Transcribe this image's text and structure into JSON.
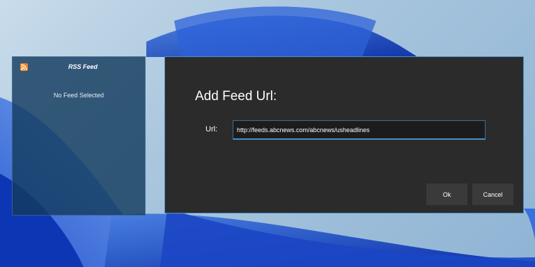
{
  "desktop": {
    "wallpaper": "windows-11-bloom"
  },
  "rss_widget": {
    "icon": "rss-icon",
    "title": "RSS Feed",
    "empty_message": "No Feed Selected",
    "accent_color": "#f08a24"
  },
  "add_feed_dialog": {
    "heading": "Add Feed Url:",
    "url_label": "Url:",
    "url_value": "http://feeds.abcnews.com/abcnews/usheadlines",
    "ok_label": "Ok",
    "cancel_label": "Cancel",
    "border_color": "#4a90c8"
  }
}
